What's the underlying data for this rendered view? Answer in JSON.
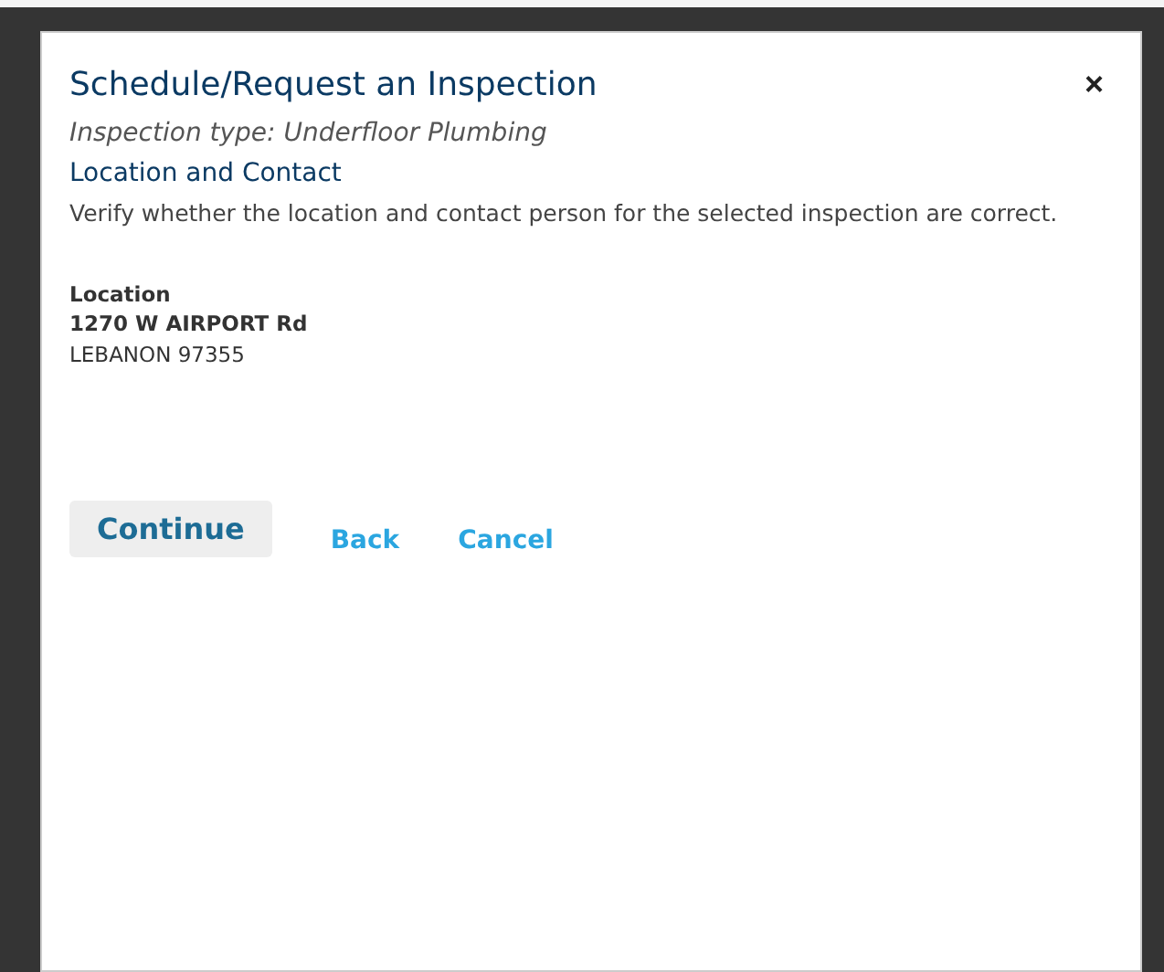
{
  "dialog": {
    "title": "Schedule/Request an Inspection",
    "close": "×",
    "inspection_type": "Inspection type: Underfloor Plumbing",
    "section_title": "Location and Contact",
    "description": "Verify whether the location and contact person for the selected inspection are correct.",
    "location": {
      "label": "Location",
      "lines": [
        "1270 W AIRPORT Rd",
        "LEBANON 97355"
      ]
    },
    "actions": [
      {
        "kind": "button",
        "label": "Continue"
      },
      {
        "kind": "link",
        "label": "Back"
      },
      {
        "kind": "link",
        "label": "Cancel"
      }
    ]
  }
}
